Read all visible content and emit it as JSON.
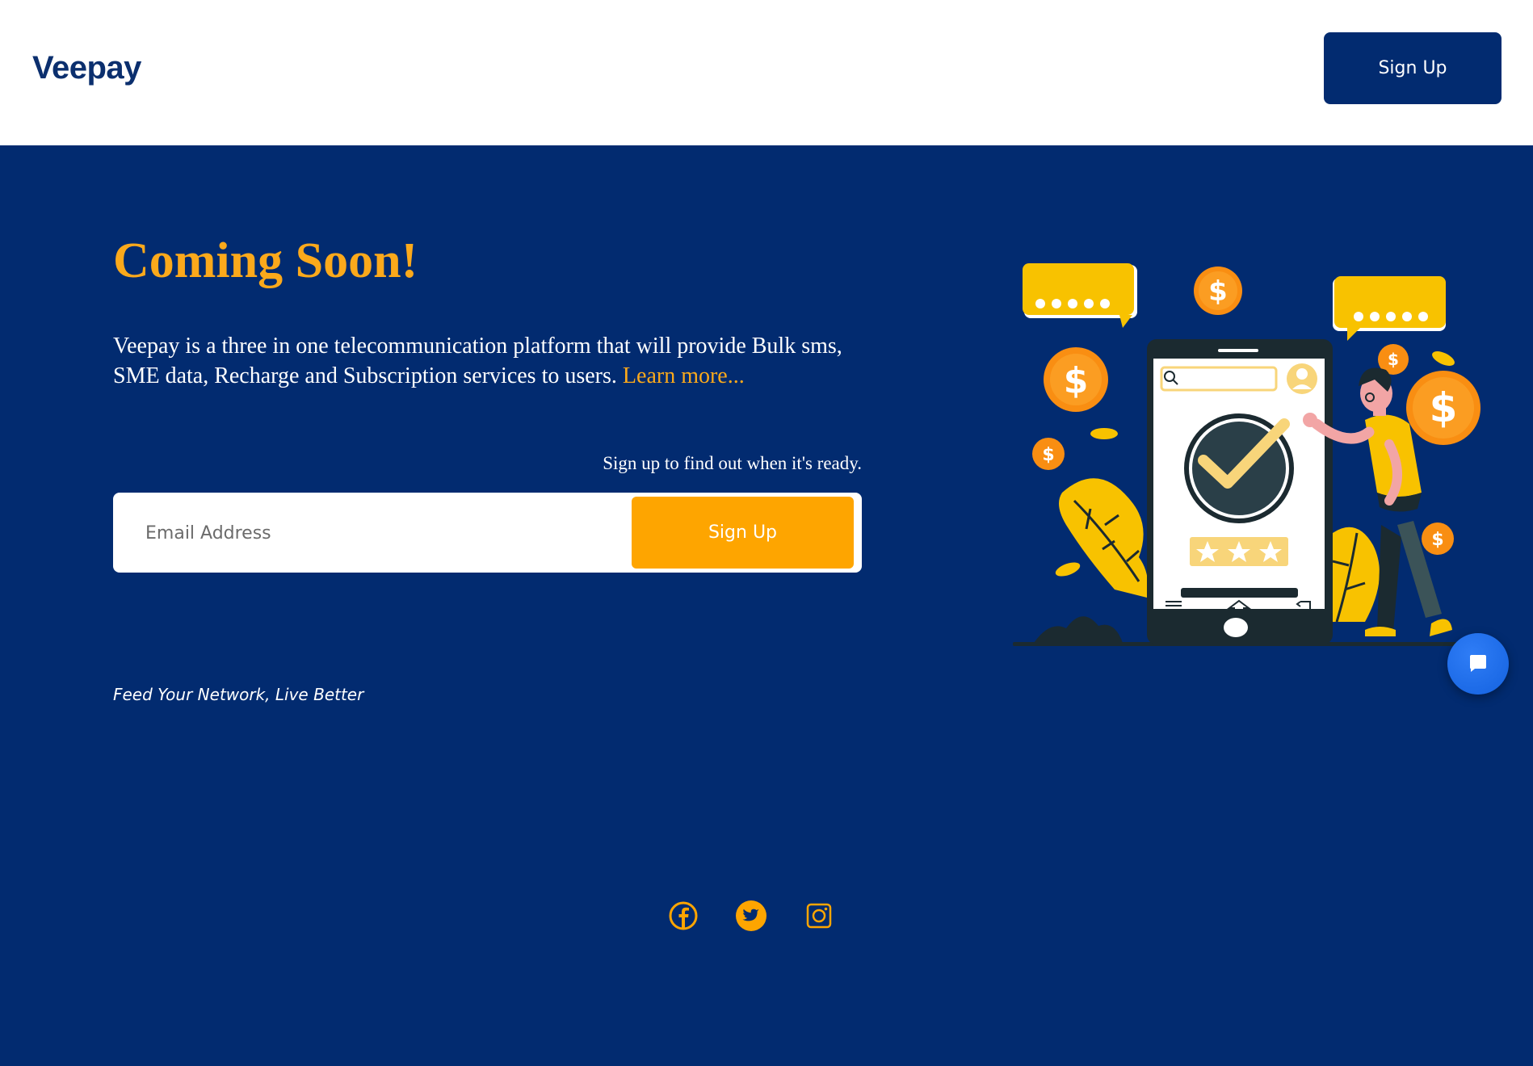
{
  "header": {
    "logo_text": "Veepay",
    "signup_label": "Sign Up"
  },
  "hero": {
    "title": "Coming Soon!",
    "description": "Veepay is a three in one telecommunication platform that will provide Bulk sms, SME data, Recharge and Subscription services to users. ",
    "learn_more": "Learn more...",
    "signup_hint": "Sign up to find out when it's ready."
  },
  "form": {
    "email_placeholder": "Email Address",
    "submit_label": "Sign Up"
  },
  "tagline": "Feed Your Network, Live Better",
  "socials": [
    {
      "icon": "facebook-icon"
    },
    {
      "icon": "twitter-icon"
    },
    {
      "icon": "instagram-icon"
    }
  ],
  "colors": {
    "brand_navy": "#022B70",
    "accent_orange": "#FEA500",
    "title_orange": "#FBA91B",
    "chat_blue": "#1462E0"
  },
  "chat": {
    "icon": "chat-bubble-icon"
  }
}
